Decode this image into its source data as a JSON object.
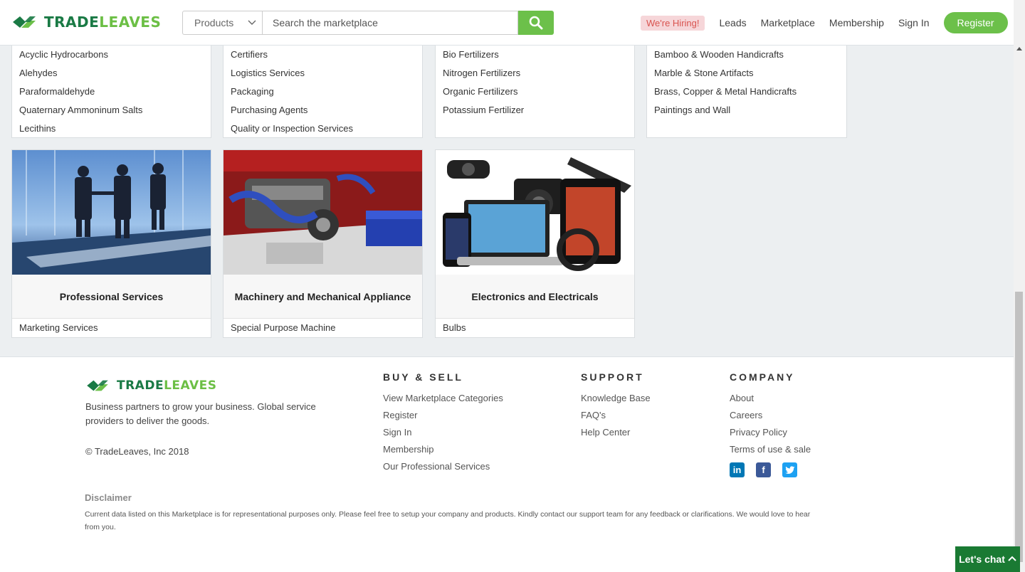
{
  "header": {
    "logo_text_1": "TRADE",
    "logo_text_2": "LEAVES",
    "search_category": "Products",
    "search_placeholder": "Search the marketplace",
    "hiring": "We're Hiring!",
    "nav": [
      "Leads",
      "Marketplace",
      "Membership",
      "Sign In"
    ],
    "register": "Register"
  },
  "top_lists": [
    {
      "items": [
        "Acyclic Hydrocarbons",
        "Alehydes",
        "Paraformaldehyde",
        "Quaternary Ammoninum Salts",
        "Lecithins"
      ]
    },
    {
      "items": [
        "Certifiers",
        "Logistics Services",
        "Packaging",
        "Purchasing Agents",
        "Quality or Inspection Services"
      ]
    },
    {
      "items": [
        "Bio Fertilizers",
        "Nitrogen Fertilizers",
        "Organic Fertilizers",
        "Potassium Fertilizer"
      ]
    },
    {
      "items": [
        "Bamboo & Wooden Handicrafts",
        "Marble & Stone Artifacts",
        "Brass, Copper & Metal Handicrafts",
        "Paintings and Wall"
      ]
    }
  ],
  "cards": [
    {
      "title": "Professional Services",
      "sub": "Marketing Services",
      "image": "business-handshake-photo"
    },
    {
      "title": "Machinery and Mechanical Appliance",
      "sub": "Special Purpose Machine",
      "image": "engine-photo"
    },
    {
      "title": "Electronics and Electricals",
      "sub": "Bulbs",
      "image": "electronics-gadgets-photo"
    }
  ],
  "footer": {
    "logo_text_1": "TRADE",
    "logo_text_2": "LEAVES",
    "description": "Business partners to grow your business. Global service providers to deliver the goods.",
    "copyright": "© TradeLeaves, Inc 2018",
    "buy_sell": {
      "title": "BUY & SELL",
      "links": [
        "View Marketplace Categories",
        "Register",
        "Sign In",
        "Membership",
        "Our Professional Services"
      ]
    },
    "support": {
      "title": "SUPPORT",
      "links": [
        "Knowledge Base",
        "FAQ's",
        "Help Center"
      ]
    },
    "company": {
      "title": "COMPANY",
      "links": [
        "About",
        "Careers",
        "Privacy Policy",
        "Terms of use & sale"
      ]
    },
    "social": [
      {
        "icon": "linkedin-icon",
        "glyph": "in",
        "color": "#0077b5"
      },
      {
        "icon": "facebook-icon",
        "glyph": "f",
        "color": "#3b5998"
      },
      {
        "icon": "twitter-icon",
        "glyph": "t",
        "color": "#1da1f2"
      }
    ],
    "disclaimer_title": "Disclaimer",
    "disclaimer_text": "Current data listed on this Marketplace is for representational purposes only. Please feel free to setup your company and products. Kindly contact our support team for any feedback or clarifications. We would love to hear from you."
  },
  "chat": {
    "label": "Let's chat"
  },
  "colors": {
    "brand_green": "#6cc04a",
    "brand_dark": "#1a7a45",
    "chat_bg": "#1a7a33"
  }
}
